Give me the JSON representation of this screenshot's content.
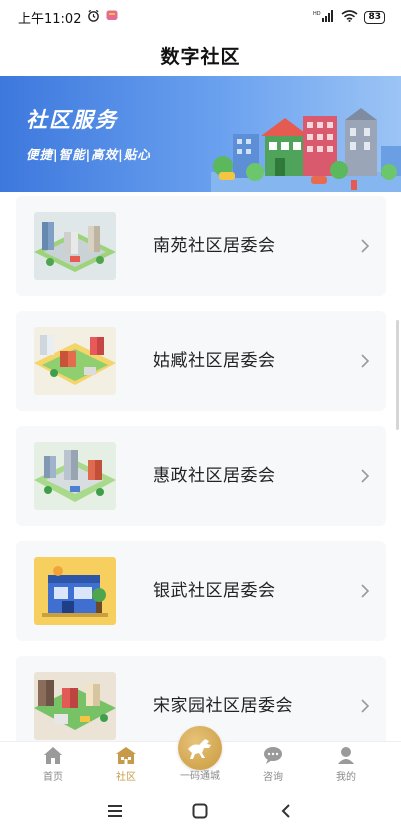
{
  "status_bar": {
    "time": "上午11:02",
    "battery": "83",
    "signal_label": "HD"
  },
  "header": {
    "title": "数字社区"
  },
  "banner": {
    "title": "社区服务",
    "subtitle": "便捷|智能|高效|贴心"
  },
  "communities": [
    {
      "label": "南苑社区居委会",
      "thumb": "isometric-city-icon"
    },
    {
      "label": "姑臧社区居委会",
      "thumb": "isometric-city-icon"
    },
    {
      "label": "惠政社区居委会",
      "thumb": "isometric-city-icon"
    },
    {
      "label": "银武社区居委会",
      "thumb": "storefront-icon"
    },
    {
      "label": "宋家园社区居委会",
      "thumb": "isometric-city-icon"
    }
  ],
  "tabbar": {
    "tabs": [
      {
        "label": "首页",
        "icon": "home-icon"
      },
      {
        "label": "社区",
        "icon": "community-icon",
        "active": true
      },
      {
        "label": "一码通城",
        "icon": "horse-icon"
      },
      {
        "label": "咨询",
        "icon": "chat-icon"
      },
      {
        "label": "我的",
        "icon": "profile-icon"
      }
    ]
  },
  "colors": {
    "accent": "#c79a4a",
    "banner": "#3d78dd",
    "card_bg": "#f7f8fa"
  }
}
